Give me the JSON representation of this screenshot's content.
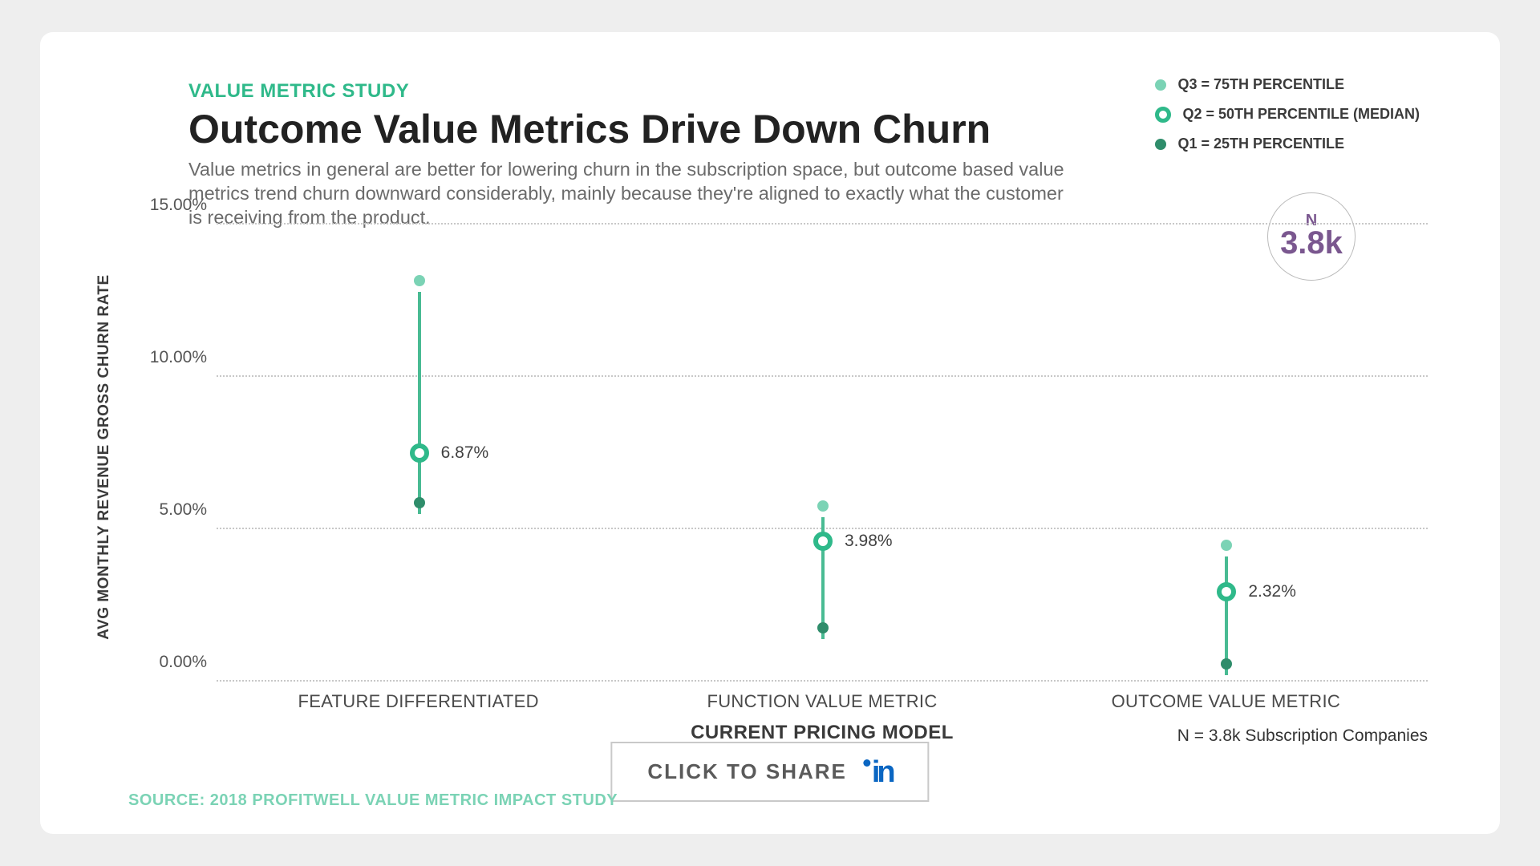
{
  "eyebrow": "VALUE METRIC STUDY",
  "title": "Outcome Value Metrics Drive Down Churn",
  "subtitle": "Value metrics in general are better for lowering churn in the subscription space, but outcome based value metrics trend churn downward considerably, mainly because they're aligned to exactly what the customer is receiving from the product.",
  "legend": {
    "q3": "Q3 = 75TH PERCENTILE",
    "q2": "Q2 = 50TH PERCENTILE (MEDIAN)",
    "q1": "Q1 = 25TH PERCENTILE"
  },
  "n_badge": {
    "label": "N",
    "value": "3.8k"
  },
  "y_axis_label": "AVG MONTHLY REVENUE GROSS CHURN RATE",
  "x_axis_label": "CURRENT PRICING MODEL",
  "y_ticks": [
    "0.00%",
    "5.00%",
    "10.00%",
    "15.00%"
  ],
  "chart_data": {
    "type": "scatter",
    "title": "Outcome Value Metrics Drive Down Churn",
    "xlabel": "CURRENT PRICING MODEL",
    "ylabel": "AVG MONTHLY REVENUE GROSS CHURN RATE",
    "ylim": [
      0,
      15
    ],
    "categories": [
      "FEATURE DIFFERENTIATED",
      "FUNCTION VALUE METRIC",
      "OUTCOME VALUE METRIC"
    ],
    "series": [
      {
        "name": "Q1 = 25th Percentile",
        "values": [
          5.5,
          1.4,
          0.2
        ]
      },
      {
        "name": "Q2 = 50th Percentile (Median)",
        "values": [
          6.87,
          3.98,
          2.32
        ]
      },
      {
        "name": "Q3 = 75th Percentile",
        "values": [
          12.8,
          5.4,
          4.1
        ]
      }
    ],
    "median_labels": [
      "6.87%",
      "3.98%",
      "2.32%"
    ]
  },
  "footnote_right": "N = 3.8k Subscription Companies",
  "share_label": "CLICK TO SHARE",
  "source": "SOURCE: 2018 PROFITWELL VALUE METRIC IMPACT STUDY"
}
